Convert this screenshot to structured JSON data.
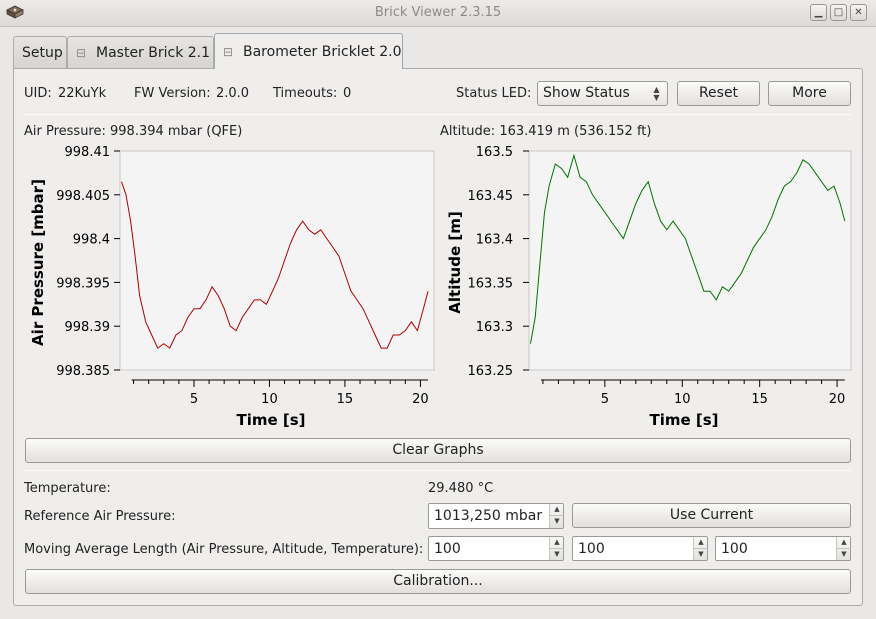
{
  "window": {
    "title": "Brick Viewer 2.3.15"
  },
  "tabs": [
    {
      "label": "Setup"
    },
    {
      "label": "Master Brick 2.1"
    },
    {
      "label": "Barometer Bricklet 2.0"
    }
  ],
  "info": {
    "uid_label": "UID:",
    "uid_value": "22KuYk",
    "fw_label": "FW Version:",
    "fw_value": "2.0.0",
    "timeouts_label": "Timeouts:",
    "timeouts_value": "0",
    "status_led_label": "Status LED:",
    "status_led_value": "Show Status",
    "reset_label": "Reset",
    "more_label": "More"
  },
  "readings": {
    "air_pressure": "Air Pressure: 998.394 mbar (QFE)",
    "altitude": "Altitude: 163.419 m (536.152 ft)"
  },
  "clear_graphs_label": "Clear Graphs",
  "settings": {
    "temperature_label": "Temperature:",
    "temperature_value": "29.480 °C",
    "reference_label": "Reference Air Pressure:",
    "reference_value": "1013,250 mbar",
    "use_current_label": "Use Current",
    "moving_avg_label": "Moving Average Length (Air Pressure, Altitude, Temperature):",
    "moving_avg_values": [
      "100",
      "100",
      "100"
    ],
    "calibration_label": "Calibration..."
  },
  "colors": {
    "pressure_line": "#b00000",
    "altitude_line": "#007400",
    "plot_bg": "#f4f4f4"
  },
  "chart_data": [
    {
      "type": "line",
      "xlabel": "Time [s]",
      "ylabel": "Air Pressure [mbar]",
      "xlim": [
        0.1,
        20.9
      ],
      "ylim": [
        998.385,
        998.41
      ],
      "xticks": [
        "5",
        "10",
        "15",
        "20"
      ],
      "yticks": [
        "998.41",
        "998.405",
        "998.4",
        "998.395",
        "998.39",
        "998.385"
      ],
      "series": [
        {
          "x": [
            0.2,
            0.5,
            0.8,
            1.1,
            1.4,
            1.8,
            2.2,
            2.6,
            3.0,
            3.4,
            3.8,
            4.2,
            4.6,
            5.0,
            5.4,
            5.8,
            6.2,
            6.6,
            7.0,
            7.4,
            7.8,
            8.2,
            8.6,
            9.0,
            9.4,
            9.8,
            10.2,
            10.6,
            11.0,
            11.4,
            11.8,
            12.2,
            12.6,
            13.0,
            13.4,
            13.8,
            14.2,
            14.6,
            15.0,
            15.4,
            15.8,
            16.2,
            16.6,
            17.0,
            17.4,
            17.8,
            18.2,
            18.6,
            19.0,
            19.4,
            19.8,
            20.2,
            20.5
          ],
          "y": [
            998.4065,
            998.405,
            998.402,
            998.398,
            998.3935,
            998.3905,
            998.389,
            998.3875,
            998.388,
            998.3875,
            998.389,
            998.3895,
            998.391,
            998.392,
            998.392,
            998.393,
            998.3945,
            998.3935,
            998.392,
            998.39,
            998.3895,
            998.391,
            998.392,
            998.393,
            998.393,
            998.3925,
            998.394,
            998.3955,
            998.3975,
            998.3995,
            998.401,
            998.402,
            998.401,
            998.4005,
            998.401,
            998.4,
            998.399,
            998.398,
            998.396,
            998.394,
            998.393,
            998.392,
            998.3905,
            998.389,
            998.3875,
            998.3875,
            998.389,
            998.389,
            998.3895,
            998.3905,
            998.3895,
            998.392,
            998.394
          ]
        }
      ]
    },
    {
      "type": "line",
      "xlabel": "Time [s]",
      "ylabel": "Altitude [m]",
      "xlim": [
        0.1,
        20.9
      ],
      "ylim": [
        163.25,
        163.5
      ],
      "xticks": [
        "5",
        "10",
        "15",
        "20"
      ],
      "yticks": [
        "163.5",
        "163.45",
        "163.4",
        "163.35",
        "163.3",
        "163.25"
      ],
      "series": [
        {
          "x": [
            0.2,
            0.5,
            0.8,
            1.1,
            1.4,
            1.8,
            2.2,
            2.6,
            3.0,
            3.4,
            3.8,
            4.2,
            4.6,
            5.0,
            5.4,
            5.8,
            6.2,
            6.6,
            7.0,
            7.4,
            7.8,
            8.2,
            8.6,
            9.0,
            9.4,
            9.8,
            10.2,
            10.6,
            11.0,
            11.4,
            11.8,
            12.2,
            12.6,
            13.0,
            13.4,
            13.8,
            14.2,
            14.6,
            15.0,
            15.4,
            15.8,
            16.2,
            16.6,
            17.0,
            17.4,
            17.8,
            18.2,
            18.6,
            19.0,
            19.4,
            19.8,
            20.2,
            20.5
          ],
          "y": [
            163.28,
            163.31,
            163.37,
            163.43,
            163.46,
            163.485,
            163.48,
            163.47,
            163.495,
            163.47,
            163.465,
            163.45,
            163.44,
            163.43,
            163.42,
            163.41,
            163.4,
            163.42,
            163.44,
            163.455,
            163.465,
            163.44,
            163.42,
            163.41,
            163.42,
            163.41,
            163.4,
            163.38,
            163.36,
            163.34,
            163.34,
            163.33,
            163.345,
            163.34,
            163.35,
            163.36,
            163.375,
            163.39,
            163.4,
            163.41,
            163.425,
            163.445,
            163.46,
            163.465,
            163.475,
            163.49,
            163.485,
            163.475,
            163.465,
            163.455,
            163.46,
            163.44,
            163.42
          ]
        }
      ]
    }
  ]
}
